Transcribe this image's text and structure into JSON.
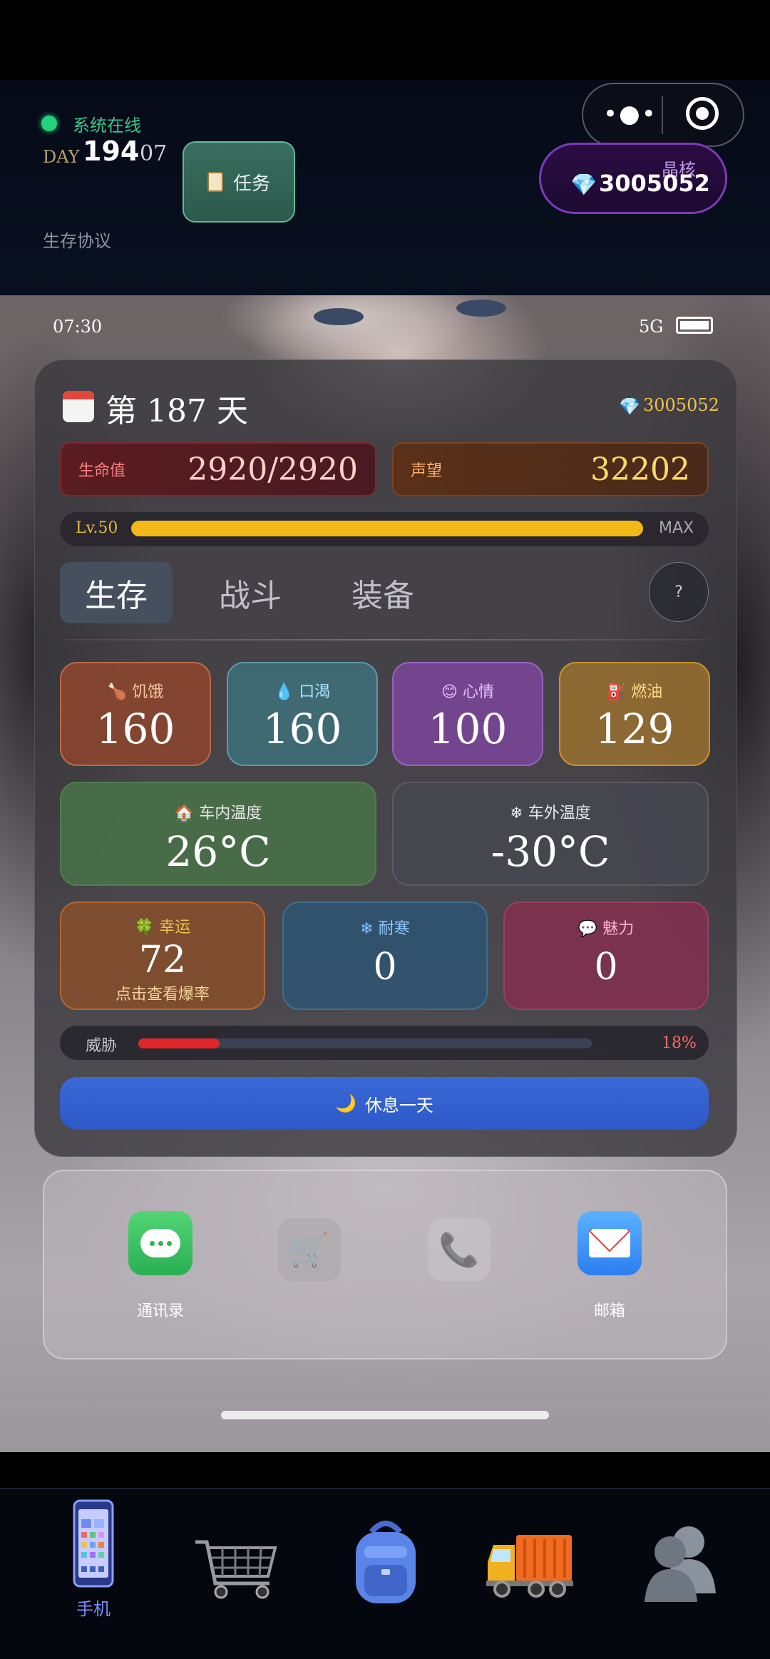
{
  "header": {
    "status_text": "系统在线",
    "day_label": "DAY",
    "day_number": "194",
    "day_sub": "07",
    "task_button": "任务",
    "protocol_link": "生存协议",
    "crystal_label": "晶核",
    "crystal_value": "3005052"
  },
  "capsule": {
    "more": "•●•"
  },
  "phone": {
    "time": "07:30",
    "network": "5G",
    "panel": {
      "title": "第 187 天",
      "gems": "3005052",
      "hp_label": "生命值",
      "hp_value": "2920/2920",
      "rep_label": "声望",
      "rep_value": "32202",
      "level_label": "Lv.50",
      "level_max": "MAX",
      "level_progress": 1.0,
      "tabs": [
        "生存",
        "战斗",
        "装备"
      ],
      "help": "?",
      "stats": {
        "hunger_label": "饥饿",
        "hunger": "160",
        "thirst_label": "口渴",
        "thirst": "160",
        "mood_label": "心情",
        "mood": "100",
        "fuel_label": "燃油",
        "fuel": "129",
        "intemp_label": "车内温度",
        "intemp": "26°C",
        "outtemp_label": "车外温度",
        "outtemp": "-30°C",
        "luck_label": "幸运",
        "luck": "72",
        "luck_hint": "点击查看爆率",
        "cold_label": "耐寒",
        "cold": "0",
        "charm_label": "魅力",
        "charm": "0"
      },
      "threat_label": "威胁",
      "threat_pct": "18%",
      "threat_value": 0.18,
      "rest_button": "休息一天"
    },
    "dock": {
      "contacts_label": "通讯录",
      "mail_label": "邮箱"
    }
  },
  "nav": {
    "phone_label": "手机",
    "items": [
      "phone-icon",
      "cart-icon",
      "backpack-icon",
      "truck-icon",
      "friends-icon"
    ]
  },
  "colors": {
    "accent_green": "#26d07c",
    "level_fill": "#f2b818",
    "threat_fill": "#e0262a",
    "rest_button": "#2c58c8",
    "nav_active": "#7a8cff"
  }
}
